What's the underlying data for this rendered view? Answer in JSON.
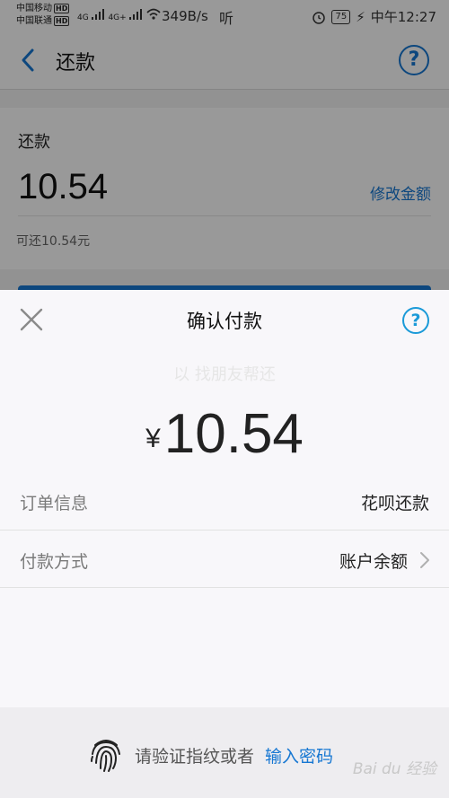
{
  "status_bar": {
    "carrier_1": "中国移动",
    "carrier_1_badge": "HD",
    "carrier_2": "中国联通",
    "carrier_2_badge": "HD",
    "network_1": "4G",
    "network_2": "4G+",
    "speed": "349B/s",
    "listen": "听",
    "battery": "75",
    "time": "中午12:27"
  },
  "nav": {
    "title": "还款",
    "help_glyph": "?"
  },
  "card": {
    "label": "还款",
    "amount": "10.54",
    "edit_link": "修改金额",
    "hint": "可还10.54元"
  },
  "sheet": {
    "title": "确认付款",
    "help_glyph": "?",
    "ghost_text": "以 找朋友帮还",
    "currency": "¥",
    "amount": "10.54",
    "rows": [
      {
        "label": "订单信息",
        "value": "花呗还款"
      },
      {
        "label": "付款方式",
        "value": "账户余额"
      }
    ],
    "footer": {
      "prompt": "请验证指纹或者",
      "link": "输入密码"
    },
    "watermark": "Bai du 经验"
  },
  "colors": {
    "accent": "#1677d2",
    "help_blue": "#1a9ad8"
  }
}
